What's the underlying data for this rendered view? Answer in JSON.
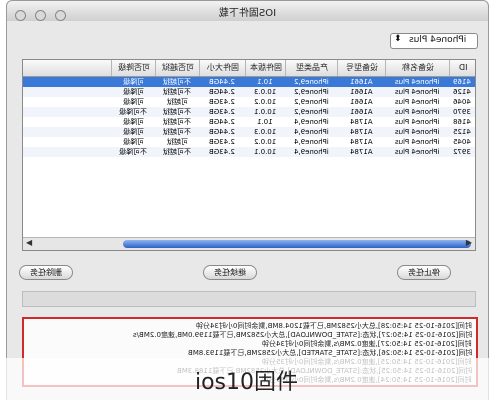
{
  "window": {
    "title": "IOS固件下载"
  },
  "device_select": {
    "value": "iPhone4 Plus"
  },
  "table": {
    "columns": [
      "ID",
      "设备名称",
      "设备型号",
      "产品类型",
      "固件版本",
      "固件大小",
      "可否越狱",
      "可否降级"
    ],
    "rows": [
      [
        "4169",
        "iPhone4 Plus",
        "A1661",
        "iPhone9,2",
        "10.1",
        "2.44GB",
        "不可越狱",
        "可降级"
      ],
      [
        "4126",
        "iPhone4 Plus",
        "A1661",
        "iPhone9,2",
        "10.0.3",
        "2.44GB",
        "不可越狱",
        "可降级"
      ],
      [
        "4046",
        "iPhone4 Plus",
        "A1661",
        "iPhone9,2",
        "10.0.2",
        "2.43GB",
        "可越狱",
        "可降级"
      ],
      [
        "3970",
        "iPhone4 Plus",
        "A1661",
        "iPhone9,2",
        "10.0.1",
        "2.43GB",
        "不可越狱",
        "不可降级"
      ],
      [
        "4168",
        "iPhone4 Plus",
        "A1784",
        "iPhone9,4",
        "10.1",
        "2.44GB",
        "不可越狱",
        "可降级"
      ],
      [
        "4125",
        "iPhone4 Plus",
        "A1784",
        "iPhone9,4",
        "10.0.3",
        "2.44GB",
        "不可越狱",
        "可降级"
      ],
      [
        "4045",
        "iPhone4 Plus",
        "A1784",
        "iPhone9,4",
        "10.0.2",
        "2.43GB",
        "可越狱",
        "可降级"
      ],
      [
        "3972",
        "iPhone4 Plus",
        "A1784",
        "iPhone9,4",
        "10.0.1",
        "2.43GB",
        "不可越狱",
        "不可降级"
      ]
    ]
  },
  "buttons": {
    "stop": "停止任务",
    "continue": "继续任务",
    "delete": "删除任务"
  },
  "log": {
    "lines": [
      "时间[2016-10-25 14:50:28],总大小2582MB,已下载1204.8MB,剩余时间0小时34分钟",
      "时间[2016-10-25 14:50:27],状态:[STATE_DOWNLOAD],总大小2582MB,已下载1199.0MB,速度0.2MB/s",
      "时间[2016-10-25 14:50:27],速度0.2MB/s,剩余时间0小时34分钟",
      "时间[2016-10-25 14:50:26],状态:[STATE_STARTED],总大小2582MB,已下载1193.8MB",
      "时间[2016-10-25 14:50:25],速度0.2MB/s,剩余时间0小时35分钟",
      "时间[2016-10-25 14:50:25],状态:[STATE_DOWNLOAD],总大小2582MB,已下载1188.3MB",
      "时间[2016-10-25 14:50:24],速度0.2MB/s,剩余时间0小时35分钟"
    ]
  },
  "caption": "ios10固件"
}
